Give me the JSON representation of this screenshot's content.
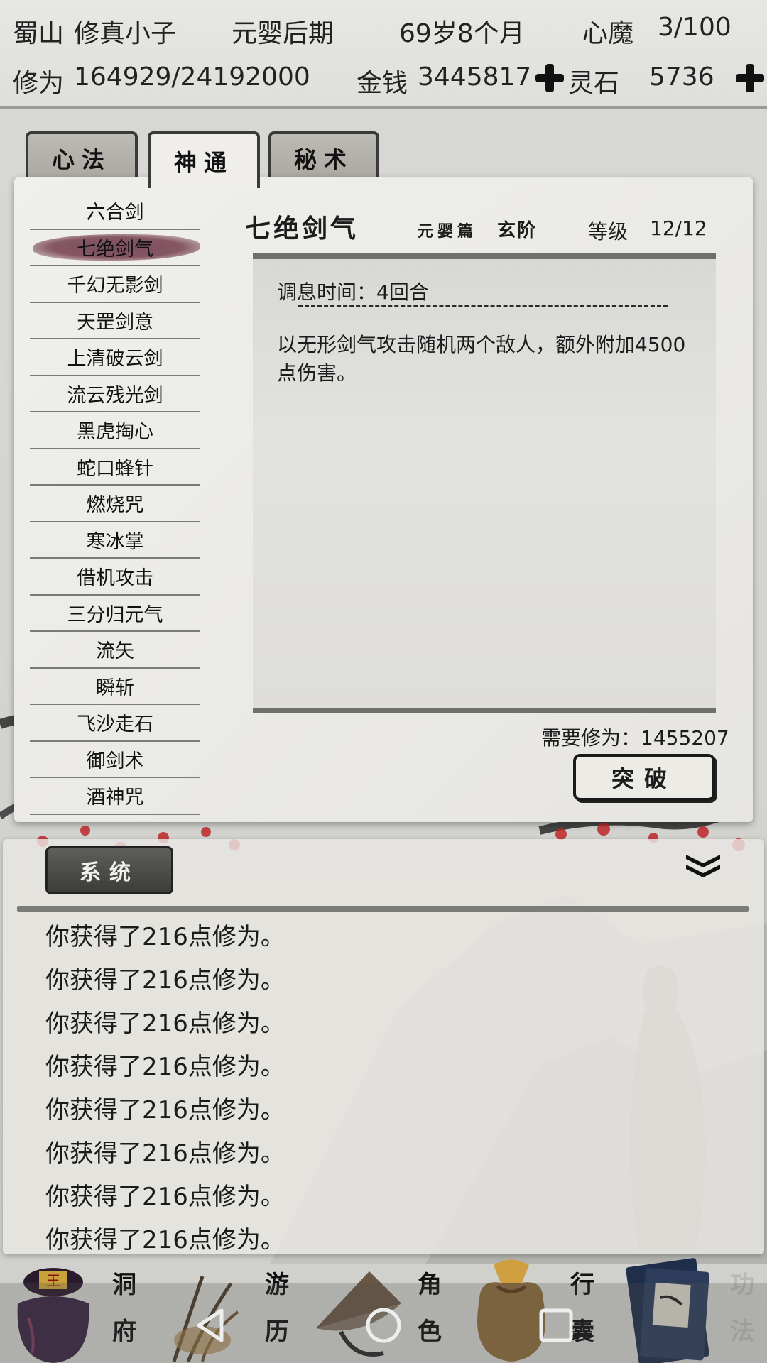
{
  "header": {
    "sect": "蜀山",
    "name": "修真小子",
    "realm": "元婴后期",
    "age": "69岁8个月",
    "demon_label": "心魔",
    "demon_value": "3/100",
    "cultivation_label": "修为",
    "cultivation_value": "164929/24192000",
    "money_label": "金钱",
    "money_value": "3445817",
    "spirit_stone_label": "灵石",
    "spirit_stone_value": "5736",
    "money_add_icon": "plus-icon",
    "stone_add_icon": "plus-icon"
  },
  "tabs": [
    {
      "label": "心法",
      "active": false
    },
    {
      "label": "神通",
      "active": true
    },
    {
      "label": "秘术",
      "active": false
    }
  ],
  "skills": [
    "六合剑",
    "七绝剑气",
    "千幻无影剑",
    "天罡剑意",
    "上清破云剑",
    "流云残光剑",
    "黑虎掏心",
    "蛇口蜂针",
    "燃烧咒",
    "寒冰掌",
    "借机攻击",
    "三分归元气",
    "流矢",
    "瞬斩",
    "飞沙走石",
    "御剑术",
    "酒神咒"
  ],
  "selected_skill_index": 1,
  "detail": {
    "title": "七绝剑气",
    "subtitle": "元婴篇",
    "tier": "玄阶",
    "level_label": "等级",
    "level_value": "12/12",
    "cooldown": "调息时间：4回合",
    "description": "以无形剑气攻击随机两个敌人，额外附加4500点伤害。",
    "requirement": "需要修为：1455207",
    "break_button": "突破"
  },
  "log": {
    "tab_label": "系统",
    "collapse_icon": "double-chevron-down-icon",
    "lines": [
      "你获得了216点修为。",
      "你获得了216点修为。",
      "你获得了216点修为。",
      "你获得了216点修为。",
      "你获得了216点修为。",
      "你获得了216点修为。",
      "你获得了216点修为。",
      "你获得了216点修为。"
    ]
  },
  "nav": [
    {
      "label_top": "洞",
      "label_bottom": "府",
      "icon": "cave-bag-icon"
    },
    {
      "label_top": "游",
      "label_bottom": "历",
      "icon": "reed-icon"
    },
    {
      "label_top": "角",
      "label_bottom": "色",
      "icon": "straw-hat-icon"
    },
    {
      "label_top": "行",
      "label_bottom": "囊",
      "icon": "pouch-icon"
    },
    {
      "label_top": "功",
      "label_bottom": "法",
      "icon": "scroll-book-icon"
    }
  ],
  "system_keys": [
    "back-icon",
    "home-icon",
    "recents-icon"
  ],
  "colors": {
    "selected_highlight": "#7a4656",
    "accent_red": "#c0282a"
  }
}
